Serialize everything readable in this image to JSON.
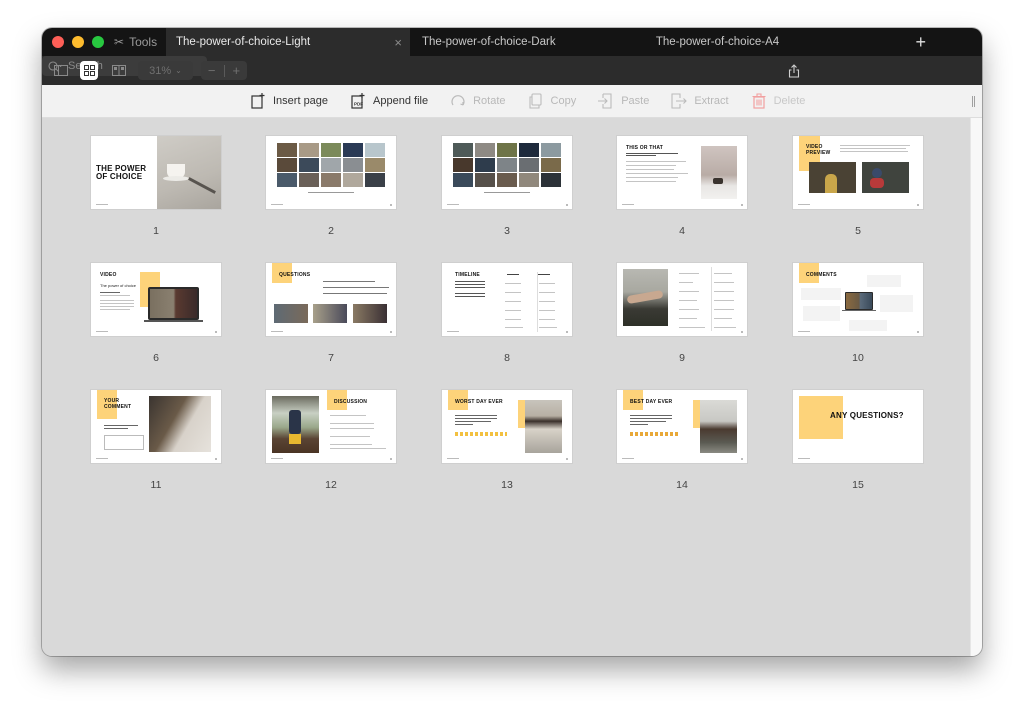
{
  "window": {
    "traffic_lights": [
      "close",
      "minimize",
      "zoom"
    ],
    "tools_label": "Tools",
    "tabs": [
      {
        "label": "The-power-of-choice-Light",
        "active": true,
        "close_icon": "×"
      },
      {
        "label": "The-power-of-choice-Dark",
        "active": false
      },
      {
        "label": "The-power-of-choice-A4",
        "active": false
      }
    ],
    "new_tab_icon": "+"
  },
  "toolbar": {
    "zoom_level": "31%",
    "zoom_minus": "−",
    "zoom_plus": "+",
    "search_placeholder": "Search"
  },
  "actions": [
    {
      "label": "Insert page",
      "icon": "insert-page-icon",
      "enabled": true
    },
    {
      "label": "Append file",
      "icon": "append-file-icon",
      "enabled": true
    },
    {
      "label": "Rotate",
      "icon": "rotate-icon",
      "enabled": false
    },
    {
      "label": "Copy",
      "icon": "copy-icon",
      "enabled": false
    },
    {
      "label": "Paste",
      "icon": "paste-icon",
      "enabled": false
    },
    {
      "label": "Extract",
      "icon": "extract-icon",
      "enabled": false
    },
    {
      "label": "Delete",
      "icon": "delete-icon",
      "enabled": false
    }
  ],
  "colors": {
    "accent_yellow": "#fdd37a",
    "delete_red": "#f2a0a0"
  },
  "pages": [
    {
      "number": "1",
      "title": "THE POWER OF CHOICE"
    },
    {
      "number": "2",
      "caption": "Look at the pictures and name the activities"
    },
    {
      "number": "3",
      "caption": "Look at the pictures and name the activities"
    },
    {
      "number": "4",
      "title": "THIS OR THAT"
    },
    {
      "number": "5",
      "title": "VIDEO PREVIEW"
    },
    {
      "number": "6",
      "title": "VIDEO",
      "subtitle": "The power of choice"
    },
    {
      "number": "7",
      "title": "QUESTIONS"
    },
    {
      "number": "8",
      "title": "TIMELINE"
    },
    {
      "number": "9"
    },
    {
      "number": "10",
      "title": "COMMENTS"
    },
    {
      "number": "11",
      "title": "YOUR COMMENT"
    },
    {
      "number": "12",
      "title": "DISCUSSION"
    },
    {
      "number": "13",
      "title": "WORST DAY EVER"
    },
    {
      "number": "14",
      "title": "BEST DAY EVER"
    },
    {
      "number": "15",
      "title": "ANY QUESTIONS?"
    }
  ]
}
